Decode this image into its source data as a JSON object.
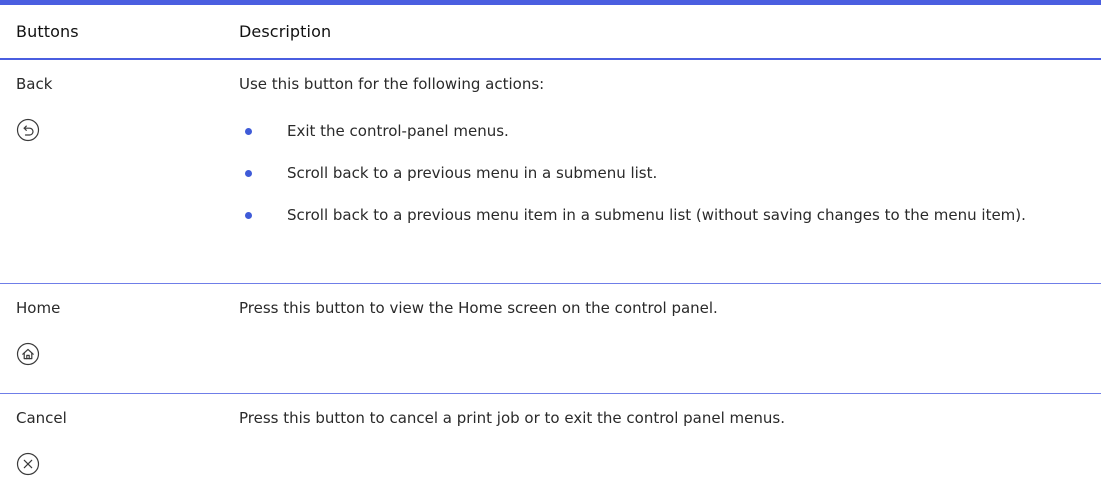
{
  "table": {
    "headers": {
      "buttons": "Buttons",
      "description": "Description"
    },
    "rows": [
      {
        "name": "Back",
        "icon": "back-icon",
        "intro": "Use this button for the following actions:",
        "bullets": [
          "Exit the control-panel menus.",
          "Scroll back to a previous menu in a submenu list.",
          "Scroll back to a previous menu item in a submenu list (without saving changes to the menu item)."
        ]
      },
      {
        "name": "Home",
        "icon": "home-icon",
        "intro": "Press this button to view the Home screen on the control panel."
      },
      {
        "name": "Cancel",
        "icon": "cancel-icon",
        "intro": "Press this button to cancel a print job or to exit the control panel menus."
      }
    ]
  },
  "colors": {
    "rule_accent": "#4a5ee0",
    "bullet": "#3f5bd8",
    "icon_stroke": "#3a3a3a"
  }
}
